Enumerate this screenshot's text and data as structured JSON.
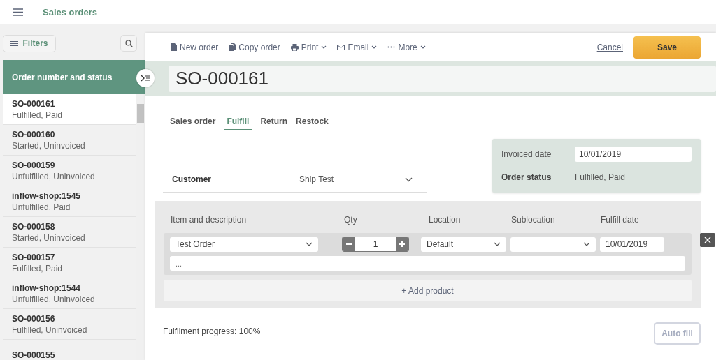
{
  "app": {
    "title": "Sales orders"
  },
  "filters_button": "Filters",
  "sidebar": {
    "header": "Order number and status",
    "items": [
      {
        "number": "SO-000161",
        "status": "Fulfilled, Paid",
        "selected": true
      },
      {
        "number": "SO-000160",
        "status": "Started, Uninvoiced",
        "selected": false
      },
      {
        "number": "SO-000159",
        "status": "Unfulfilled, Uninvoiced",
        "selected": false
      },
      {
        "number": "inflow-shop:1545",
        "status": "Unfulfilled, Paid",
        "selected": false
      },
      {
        "number": "SO-000158",
        "status": "Started, Uninvoiced",
        "selected": false
      },
      {
        "number": "SO-000157",
        "status": "Fulfilled, Paid",
        "selected": false
      },
      {
        "number": "inflow-shop:1544",
        "status": "Unfulfilled, Uninvoiced",
        "selected": false
      },
      {
        "number": "SO-000156",
        "status": "Fulfilled, Uninvoiced",
        "selected": false
      },
      {
        "number": "SO-000155",
        "selected": false
      }
    ]
  },
  "toolbar": {
    "actions": [
      {
        "label": "New order",
        "kind": "new",
        "dropdown": false
      },
      {
        "label": "Copy order",
        "kind": "copy",
        "dropdown": false
      },
      {
        "label": "Print",
        "kind": "print",
        "dropdown": true
      },
      {
        "label": "Email",
        "kind": "email",
        "dropdown": true
      },
      {
        "label": "More",
        "kind": "more",
        "dropdown": true
      }
    ],
    "cancel": "Cancel",
    "save": "Save"
  },
  "order": {
    "number": "SO-000161"
  },
  "tabs": [
    {
      "label": "Sales order",
      "selected": false
    },
    {
      "label": "Fulfill",
      "selected": true
    },
    {
      "label": "Return",
      "selected": false
    },
    {
      "label": "Restock",
      "selected": false
    }
  ],
  "customer": {
    "label": "Customer",
    "value": "Ship Test"
  },
  "summary": {
    "invoiced_label": "Invoiced date",
    "invoiced_date": "10/01/2019",
    "status_label": "Order status",
    "status_value": "Fulfilled, Paid"
  },
  "lines": {
    "columns": [
      "Item and description",
      "Qty",
      "Location",
      "Sublocation",
      "Fulfill date"
    ],
    "rows": [
      {
        "item": "Test Order",
        "qty": "1",
        "location": "Default",
        "fulfill_date": "10/01/2019",
        "description_placeholder": "..."
      }
    ],
    "add_product": "+ Add product"
  },
  "progress": "Fulfilment progress: 100%",
  "auto_fill": {
    "label": "Auto fill",
    "disabled": true
  }
}
